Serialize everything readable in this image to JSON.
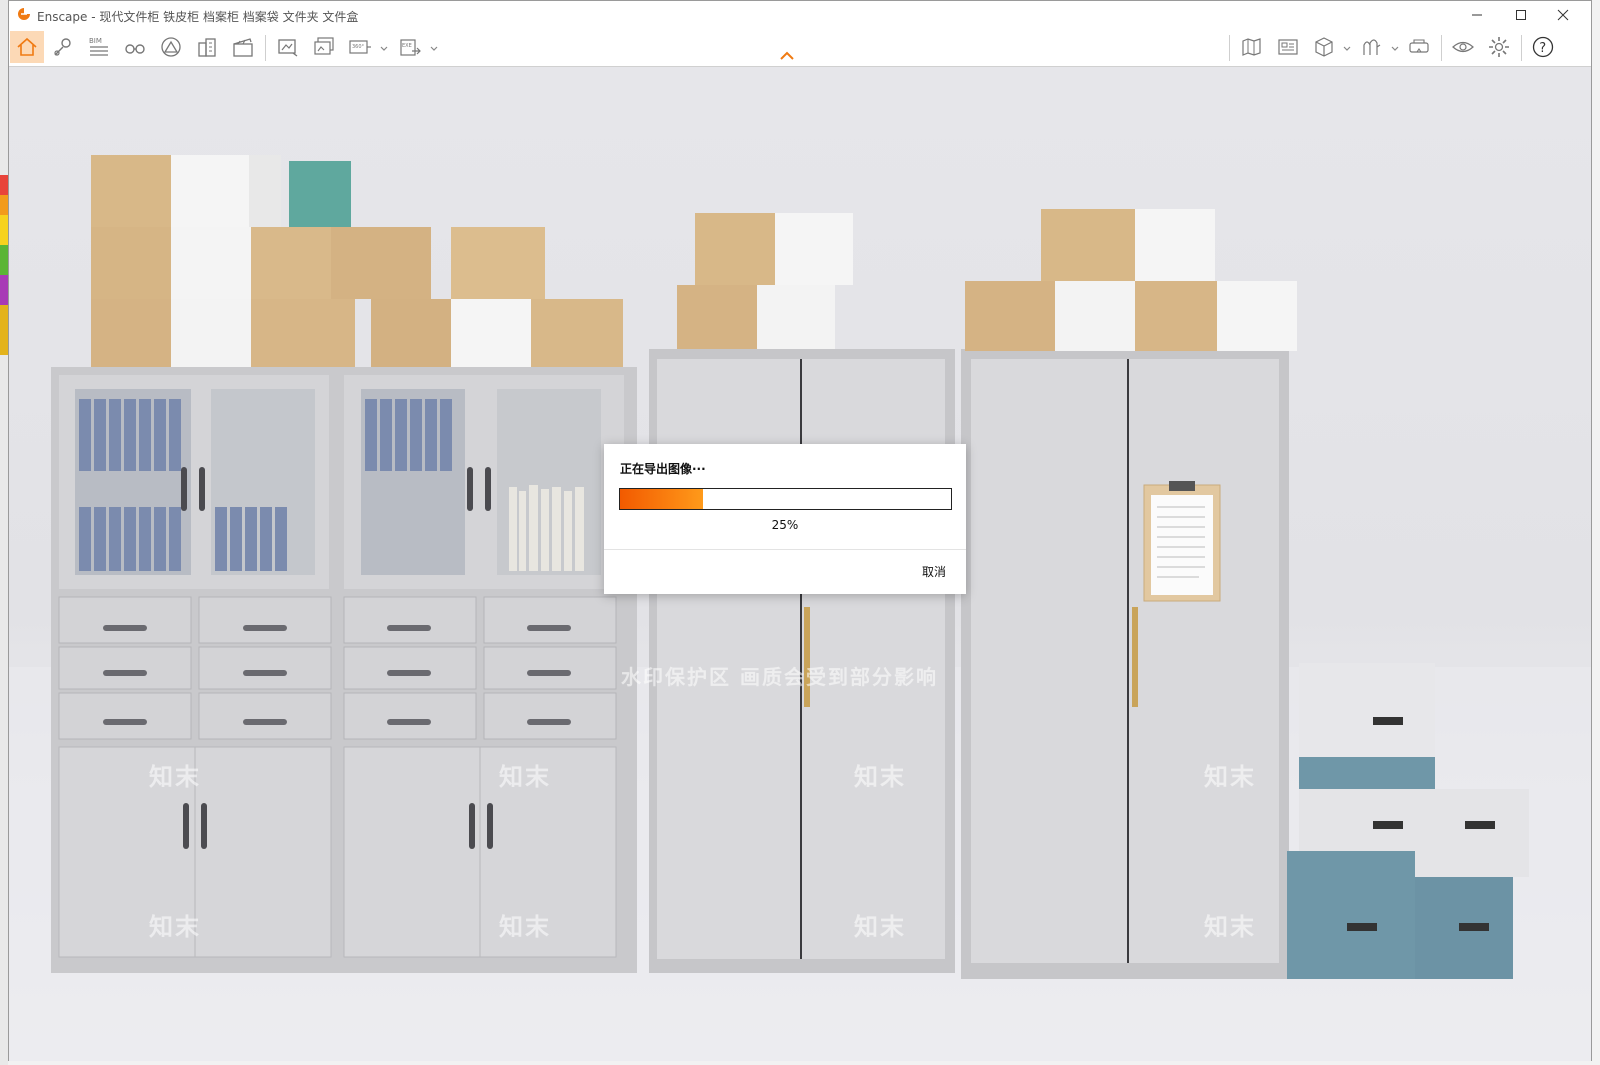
{
  "window": {
    "title": "Enscape - 现代文件柜 铁皮柜 档案柜 档案袋 文件夹 文件盒",
    "controls": [
      "minimize-icon",
      "maximize-icon",
      "close-icon"
    ]
  },
  "toolbar": {
    "left_buttons": [
      {
        "icon": "home-icon",
        "active": true
      },
      {
        "icon": "map-pin-icon"
      },
      {
        "icon": "bim-icon",
        "label": "BIM"
      },
      {
        "icon": "binoculars-icon"
      },
      {
        "icon": "mountain-icon"
      },
      {
        "icon": "buildings-icon"
      },
      {
        "icon": "clapperboard-icon"
      },
      {
        "icon": "screenshot-icon"
      },
      {
        "icon": "batch-render-icon"
      },
      {
        "icon": "panorama-360-icon",
        "label": "360°"
      },
      {
        "icon": "export-exe-icon",
        "label": "EXE"
      }
    ],
    "right_buttons": [
      {
        "icon": "map-view-icon"
      },
      {
        "icon": "asset-library-icon"
      },
      {
        "icon": "cube-view-icon"
      },
      {
        "icon": "material-editor-icon"
      },
      {
        "icon": "vr-headset-icon"
      },
      {
        "icon": "visual-settings-icon"
      },
      {
        "icon": "settings-gear-icon"
      },
      {
        "icon": "help-icon",
        "label": "?"
      }
    ],
    "colors": {
      "active_bg": "#fcd9b6",
      "accent": "#f07a12"
    }
  },
  "viewport": {
    "scene": "office-cabinets-render",
    "watermark": "水印保护区  画质会受到部分影响",
    "watermark_brand": "知末"
  },
  "dialog": {
    "title": "正在导出图像···",
    "progress_percent": 25,
    "progress_label": "25%",
    "cancel_label": "取消",
    "progress_colors": [
      "#f25a00",
      "#ff9a1a"
    ]
  }
}
